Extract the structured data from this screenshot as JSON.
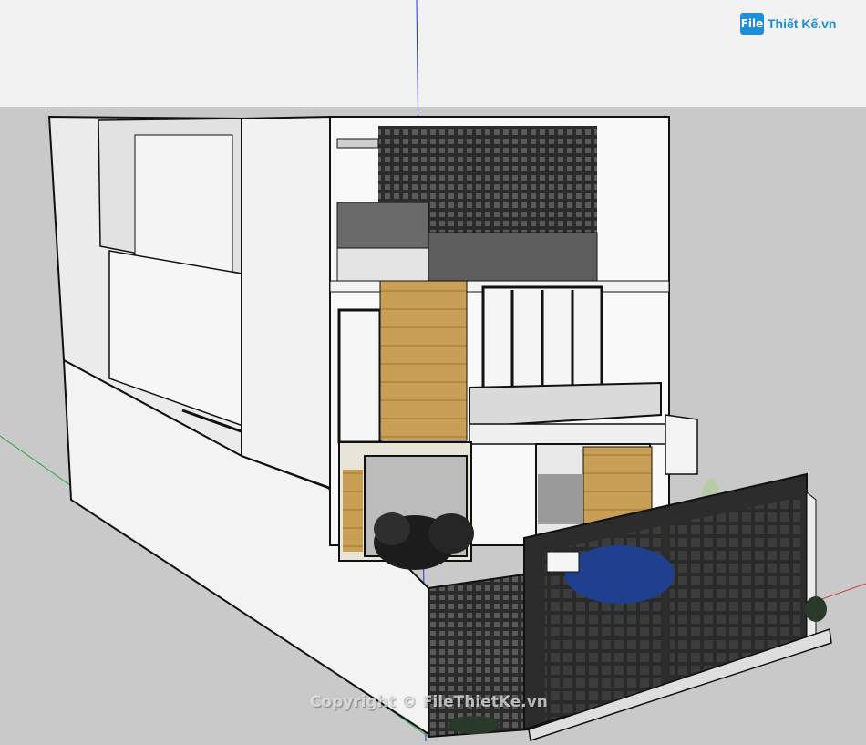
{
  "scene": {
    "subject": "",
    "sky_color": "#f2f2f2",
    "ground_color": "#c9c9c9",
    "axis_colors": {
      "blue": "#2a2ad6",
      "green": "#2fa24a",
      "red": "#d43a3a"
    }
  },
  "logo": {
    "mark": "File",
    "text": "Thiết Kế.vn"
  },
  "watermark": {
    "text": "Copyright © FileThietKe.vn"
  }
}
